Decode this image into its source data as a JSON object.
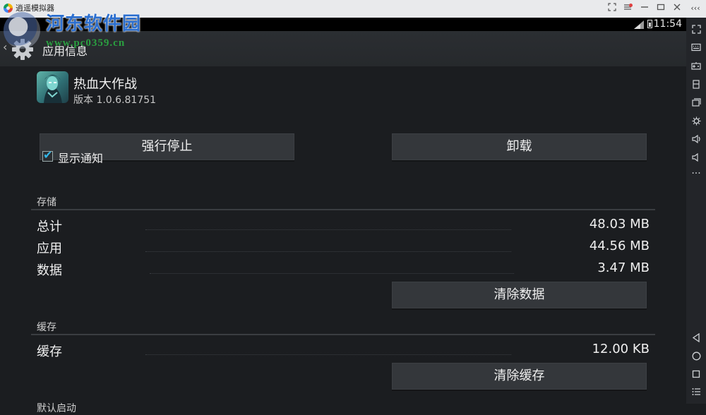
{
  "window": {
    "title": "逍遥模拟器",
    "controls": [
      "restore-icon",
      "menu-icon",
      "minimize-icon",
      "maximize-icon",
      "close-icon"
    ],
    "collapse_label": "‹‹‹"
  },
  "watermark": {
    "line1": "河东软件园",
    "line2": "www.pc0359.cn"
  },
  "status_bar": {
    "time": "11:54"
  },
  "action_bar": {
    "title": "应用信息"
  },
  "app": {
    "name": "热血大作战",
    "version": "版本 1.0.6.81751"
  },
  "buttons": {
    "force_stop": "强行停止",
    "uninstall": "卸载",
    "clear_data": "清除数据",
    "clear_cache": "清除缓存"
  },
  "notifications": {
    "label": "显示通知",
    "checked": true
  },
  "storage": {
    "header": "存储",
    "rows": [
      {
        "label": "总计",
        "value": "48.03 MB"
      },
      {
        "label": "应用",
        "value": "44.56 MB"
      },
      {
        "label": "数据",
        "value": "3.47 MB"
      }
    ]
  },
  "cache": {
    "header": "缓存",
    "rows": [
      {
        "label": "缓存",
        "value": "12.00 KB"
      }
    ]
  },
  "launch": {
    "header": "默认启动"
  },
  "side_toolbar": {
    "top_label": "‹‹‹",
    "more_label": "···",
    "icons": [
      "fullscreen-icon",
      "keyboard-icon",
      "gamepad-icon",
      "screen-rotate-icon",
      "multi-window-icon",
      "settings-icon",
      "volume-up-icon",
      "volume-down-icon",
      "more-icon",
      "back-icon",
      "home-icon",
      "recent-apps-icon",
      "menu-list-icon"
    ]
  },
  "colors": {
    "accent": "#33b5e5",
    "background": "#1b1d20",
    "button": "#34373b"
  }
}
